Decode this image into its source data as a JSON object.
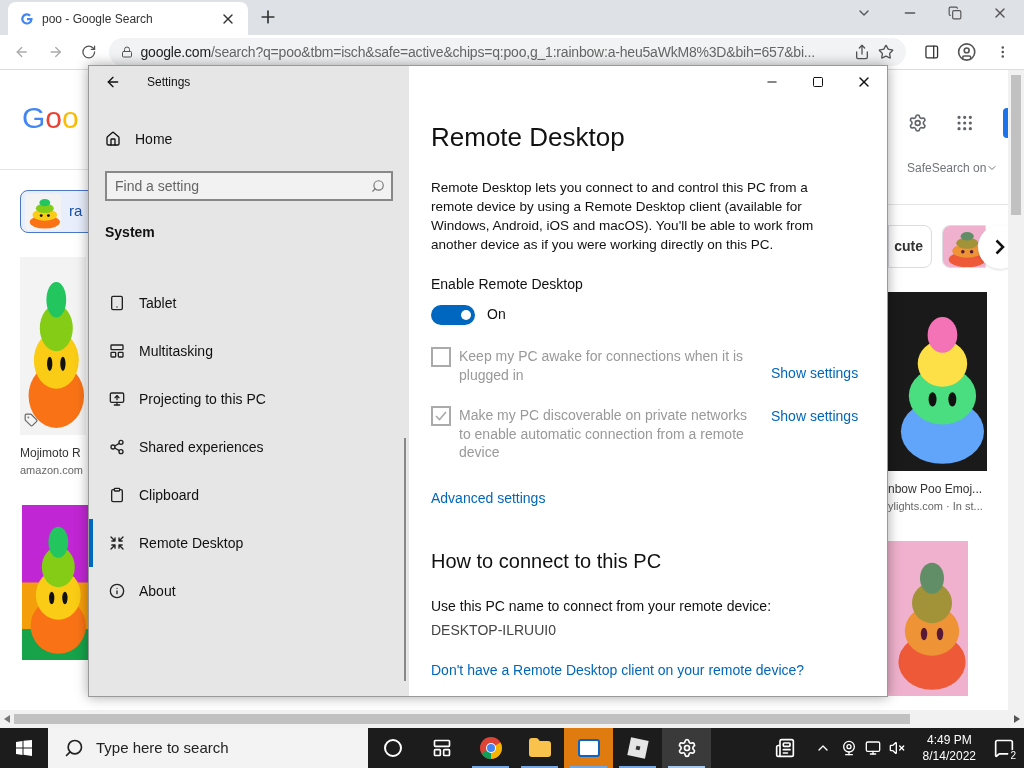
{
  "browser": {
    "tab": {
      "title": "poo - Google Search"
    },
    "address": {
      "domain": "google.com",
      "rest": "/search?q=poo&tbm=isch&safe=active&chips=q:poo,g_1:rainbow:a-heu5aWkM8%3D&bih=657&bi..."
    }
  },
  "google": {
    "logo": "Goo",
    "safesearch": "SafeSearch on",
    "chips": [
      {
        "label": "ra"
      },
      {
        "label": "cute"
      }
    ],
    "results": [
      {
        "title": "Mojimoto R",
        "source": "amazon.com"
      },
      {
        "title": "nbow Poo Emoj...",
        "source": "ylights.com · In st..."
      }
    ]
  },
  "settings": {
    "title": "Settings",
    "home": "Home",
    "search": {
      "placeholder": "Find a setting"
    },
    "section": "System",
    "nav": [
      {
        "label": "Tablet",
        "kind": "tablet",
        "selected": false
      },
      {
        "label": "Multitasking",
        "kind": "multitasking",
        "selected": false
      },
      {
        "label": "Projecting to this PC",
        "kind": "projecting",
        "selected": false
      },
      {
        "label": "Shared experiences",
        "kind": "shared",
        "selected": false
      },
      {
        "label": "Clipboard",
        "kind": "clipboard",
        "selected": false
      },
      {
        "label": "Remote Desktop",
        "kind": "remote",
        "selected": true
      },
      {
        "label": "About",
        "kind": "about",
        "selected": false
      }
    ],
    "heading": "Remote Desktop",
    "description": "Remote Desktop lets you connect to and control this PC from a remote device by using a Remote Desktop client (available for Windows, Android, iOS and macOS). You'll be able to work from another device as if you were working directly on this PC.",
    "enable_label": "Enable Remote Desktop",
    "toggle": {
      "on": true,
      "label": "On"
    },
    "options": [
      {
        "text": "Keep my PC awake for connections when it is plugged in",
        "checked": false,
        "disabled": true,
        "link": "Show settings"
      },
      {
        "text": "Make my PC discoverable on private networks to enable automatic connection from a remote device",
        "checked": true,
        "disabled": true,
        "link": "Show settings"
      }
    ],
    "advanced_link": "Advanced settings",
    "connect_heading": "How to connect to this PC",
    "connect_text": "Use this PC name to connect from your remote device:",
    "pc_name": "DESKTOP-ILRUUI0",
    "client_link": "Don't have a Remote Desktop client on your remote device?"
  },
  "taskbar": {
    "search": {
      "placeholder": "Type here to search"
    },
    "apps": [
      {
        "kind": "cortana",
        "running": false,
        "selected": false,
        "flashing": false
      },
      {
        "kind": "taskview",
        "running": false,
        "selected": false,
        "flashing": false
      },
      {
        "kind": "chrome",
        "running": true,
        "selected": false,
        "flashing": false
      },
      {
        "kind": "explorer",
        "running": true,
        "selected": false,
        "flashing": false
      },
      {
        "kind": "mail",
        "running": true,
        "selected": false,
        "flashing": true
      },
      {
        "kind": "roblox",
        "running": true,
        "selected": false,
        "flashing": false
      },
      {
        "kind": "settings",
        "running": true,
        "selected": true,
        "flashing": false
      }
    ],
    "time": "4:49 PM",
    "date": "8/14/2022",
    "notifications": "2"
  }
}
